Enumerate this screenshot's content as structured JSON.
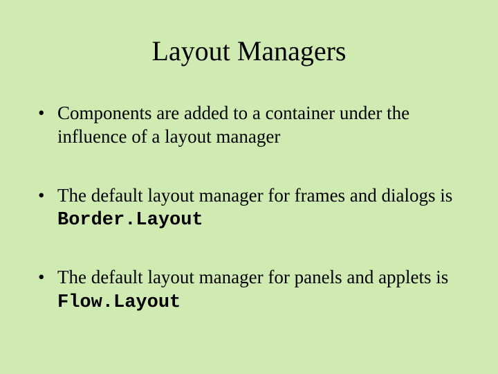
{
  "title": "Layout Managers",
  "bullets": [
    {
      "prefix": "Components are added to a container under the influence of a layout manager",
      "code": "",
      "suffix": ""
    },
    {
      "prefix": "The default layout manager for frames and dialogs is ",
      "code": "Border.Layout",
      "suffix": ""
    },
    {
      "prefix": "The default layout manager for panels and applets is ",
      "code": "Flow.Layout",
      "suffix": ""
    }
  ]
}
